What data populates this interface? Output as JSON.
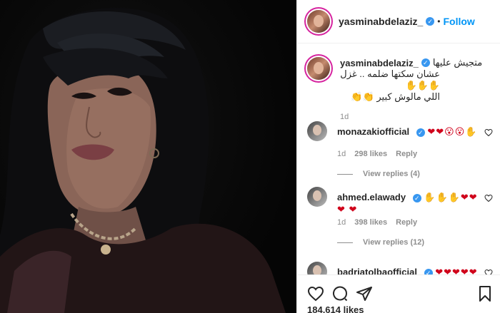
{
  "post": {
    "author": "yasminabdelaziz_",
    "verified_mark": "✓",
    "separator": "•",
    "follow_label": "Follow",
    "caption_lines": [
      "متجيش عليها",
      "عشان سكتها ضلمه .. غزل ✋✋✋",
      "اللي مالوش كبير 👏👏"
    ],
    "caption_time": "1d",
    "likes": "184,614 likes"
  },
  "comments": [
    {
      "username": "monazakiofficial",
      "text": "❤❤😮😮✋",
      "time": "1d",
      "likes": "298 likes",
      "reply_label": "Reply",
      "view_replies": "View replies (4)"
    },
    {
      "username": "ahmed.elawady",
      "text": "✋✋✋❤❤❤ ❤",
      "time": "1d",
      "likes": "398 likes",
      "reply_label": "Reply",
      "view_replies": "View replies (12)"
    },
    {
      "username": "badriatolbaofficial",
      "text": "❤❤❤❤❤"
    }
  ],
  "icons": {
    "like": "heart-icon",
    "comment": "comment-icon",
    "share": "share-icon",
    "save": "bookmark-icon"
  }
}
